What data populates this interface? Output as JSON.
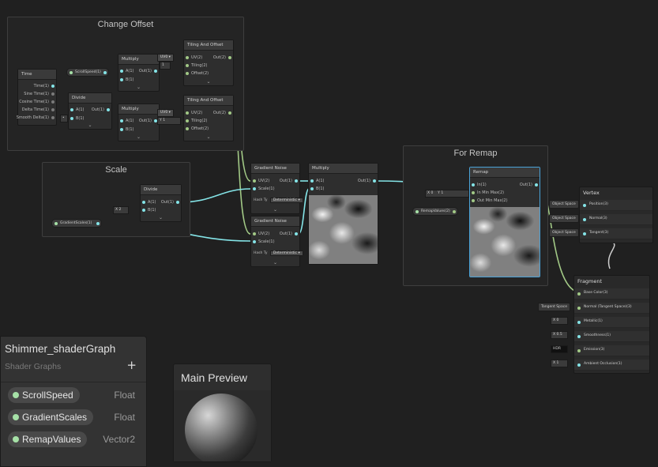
{
  "groups": {
    "change_offset": "Change Offset",
    "scale": "Scale",
    "for_remap": "For Remap"
  },
  "nodes": {
    "time": {
      "title": "Time",
      "ports": [
        "Time(1)",
        "Sine Time(1)",
        "Cosine Time(1)",
        "Delta Time(1)",
        "Smooth Delta(1)"
      ]
    },
    "scroll_speed": {
      "label": "ScrollSpeed(1)"
    },
    "divide1": {
      "title": "Divide",
      "in": [
        "A(1)",
        "B(1)"
      ],
      "out": "Out(1)"
    },
    "multiply1": {
      "title": "Multiply",
      "in": [
        "A(1)",
        "B(1)"
      ],
      "out": "Out(1)"
    },
    "multiply2": {
      "title": "Multiply",
      "in": [
        "A(1)",
        "B(1)"
      ],
      "out": "Out(1)"
    },
    "tiling1": {
      "title": "Tiling And Offset",
      "in": [
        "UV(2)",
        "Tiling(2)",
        "Offset(2)"
      ],
      "out": "Out(2)",
      "uv": "UV0",
      "field": "1"
    },
    "tiling2": {
      "title": "Tiling And Offset",
      "in": [
        "UV(2)",
        "Tiling(2)",
        "Offset(2)"
      ],
      "out": "Out(2)",
      "uv": "UV0",
      "y": "Y",
      "yval": "1"
    },
    "gn1": {
      "title": "Gradient Noise",
      "in": [
        "UV(2)",
        "Scale(1)"
      ],
      "out": "Out(1)",
      "hash": "Hash Ty",
      "hash_val": "Deterministic"
    },
    "gn2": {
      "title": "Gradient Noise",
      "in": [
        "UV(2)",
        "Scale(1)"
      ],
      "out": "Out(1)",
      "hash": "Hash Ty",
      "hash_val": "Deterministic"
    },
    "multiply3": {
      "title": "Multiply",
      "in": [
        "A(1)",
        "B(1)"
      ],
      "out": "Out(1)"
    },
    "divide2": {
      "title": "Divide",
      "in": [
        "A(1)",
        "B(1)"
      ],
      "out": "Out(1)",
      "x": "X",
      "xval": "2"
    },
    "gradient_scales": {
      "label": "GradientScales(1)"
    },
    "remap": {
      "title": "Remap",
      "in": [
        "In(1)",
        "In Min Max(2)",
        "Out Min Max(2)"
      ],
      "out": "Out(1)",
      "x": "X",
      "xval": "0",
      "y": "Y",
      "yval": "1"
    },
    "remap_values": {
      "label": "RemapValues(2)"
    }
  },
  "vertex": {
    "title": "Vertex",
    "rows": [
      {
        "label": "Position(3)",
        "space": "Object Space"
      },
      {
        "label": "Normal(3)",
        "space": "Object Space"
      },
      {
        "label": "Tangent(3)",
        "space": "Object Space"
      }
    ]
  },
  "fragment": {
    "title": "Fragment",
    "rows": [
      {
        "label": "Base Color(3)"
      },
      {
        "label": "Normal (Tangent Space)(3)",
        "input": "Tangent Space"
      },
      {
        "label": "Metallic(1)",
        "input": "X",
        "value": "0"
      },
      {
        "label": "Smoothness(1)",
        "input": "X",
        "value": "0.5"
      },
      {
        "label": "Emission(3)",
        "input": "HDR"
      },
      {
        "label": "Ambient Occlusion(1)",
        "input": "X",
        "value": "1"
      }
    ]
  },
  "blackboard": {
    "title": "Shimmer_shaderGraph",
    "subtitle": "Shader Graphs",
    "add": "+",
    "properties": [
      {
        "name": "ScrollSpeed",
        "type": "Float"
      },
      {
        "name": "GradientScales",
        "type": "Float"
      },
      {
        "name": "RemapValues",
        "type": "Vector2"
      }
    ]
  },
  "main_preview": {
    "title": "Main Preview"
  },
  "colors": {
    "float_port": "#84e4e7",
    "property_dot": "#a6e1a7",
    "vector_wire": "#a2c986",
    "selection": "#4aa3d8"
  }
}
